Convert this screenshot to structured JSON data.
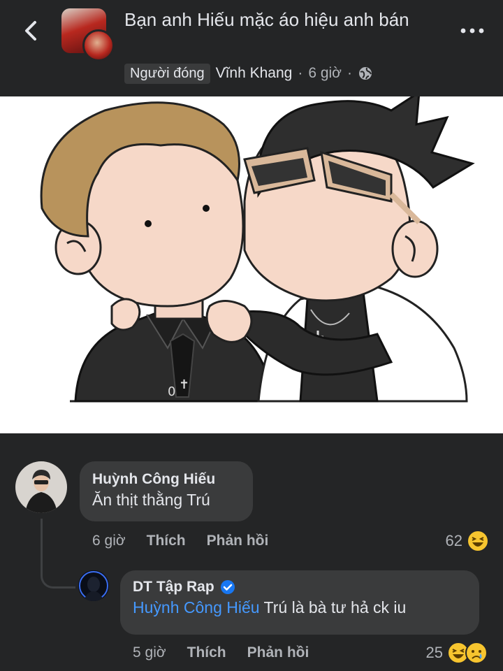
{
  "header": {
    "title": "Bạn anh Hiếu mặc áo hiệu anh bán",
    "role_badge": "Người đóng",
    "author": "Vĩnh Khang",
    "time": "6 giờ",
    "separator": "·",
    "back_icon": "chevron-left-icon",
    "more_icon": "more-dots-icon",
    "privacy_icon": "globe-icon"
  },
  "post": {
    "image_description_icon": "cartoon-kiss-illustration"
  },
  "comments": [
    {
      "author": "Huỳnh Công Hiếu",
      "text": "Ăn thịt thằng Trú",
      "time": "6 giờ",
      "like_label": "Thích",
      "reply_label": "Phản hồi",
      "reaction_count": "62"
    },
    {
      "author": "DT Tập Rap",
      "verified": true,
      "mention": "Huỳnh Công Hiếu",
      "text": "Trú là bà tư hả ck iu",
      "time": "5 giờ",
      "like_label": "Thích",
      "reply_label": "Phản hồi",
      "reaction_count": "25"
    }
  ],
  "colors": {
    "background": "#242526",
    "bubble": "#3a3b3c",
    "text": "#e4e6eb",
    "secondary": "#b0b3b8",
    "mention": "#4599ff",
    "verified": "#1877f2"
  }
}
